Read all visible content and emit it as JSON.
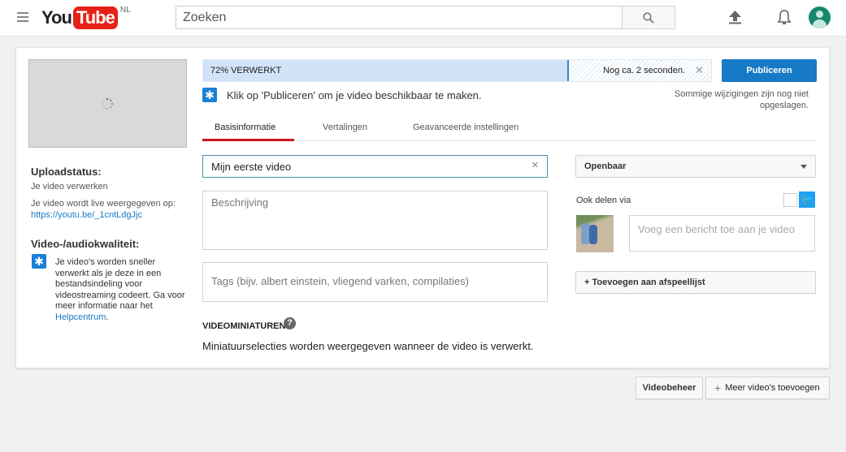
{
  "header": {
    "logo_you": "You",
    "logo_tube": "Tube",
    "region": "NL",
    "search_placeholder": "Zoeken"
  },
  "sidebar": {
    "upload_heading": "Uploadstatus:",
    "upload_status": "Je video verwerken",
    "live_text": "Je video wordt live weergegeven op:",
    "url": "https://youtu.be/_1cntLdgJjc",
    "quality_heading": "Video-/audiokwaliteit:",
    "quality_text": "Je video's worden sneller verwerkt als je deze in een bestandsindeling voor videostreaming codeert. Ga voor meer informatie naar het ",
    "help_link": "Helpcentrum",
    "period": "."
  },
  "progress": {
    "label": "72% VERWERKT",
    "percent": 72,
    "remaining": "Nog ca. 2 seconden.",
    "publish": "Publiceren"
  },
  "notice": "Klik op 'Publiceren' om je video beschikbaar te maken.",
  "unsaved": "Sommige wijzigingen zijn nog niet opgeslagen.",
  "tabs": [
    {
      "label": "Basisinformatie",
      "active": true
    },
    {
      "label": "Vertalingen"
    },
    {
      "label": "Geavanceerde instellingen"
    }
  ],
  "form": {
    "title_value": "Mijn eerste video",
    "description_placeholder": "Beschrijving",
    "tags_placeholder": "Tags (bijv. albert einstein, vliegend varken, compilaties)",
    "privacy": "Openbaar",
    "share_label": "Ook delen via",
    "message_placeholder": "Voeg een bericht toe aan je video",
    "playlist": "+ Toevoegen aan afspeellijst"
  },
  "thumbnails": {
    "heading": "VIDEOMINIATUREN",
    "text": "Miniatuurselecties worden weergegeven wanneer de video is verwerkt."
  },
  "footer": {
    "manager": "Videobeheer",
    "add_more": "Meer video's toevoegen"
  },
  "colors": {
    "accent": "#167ac6",
    "tab_active": "#cc181e",
    "twitter": "#1da1f2"
  }
}
